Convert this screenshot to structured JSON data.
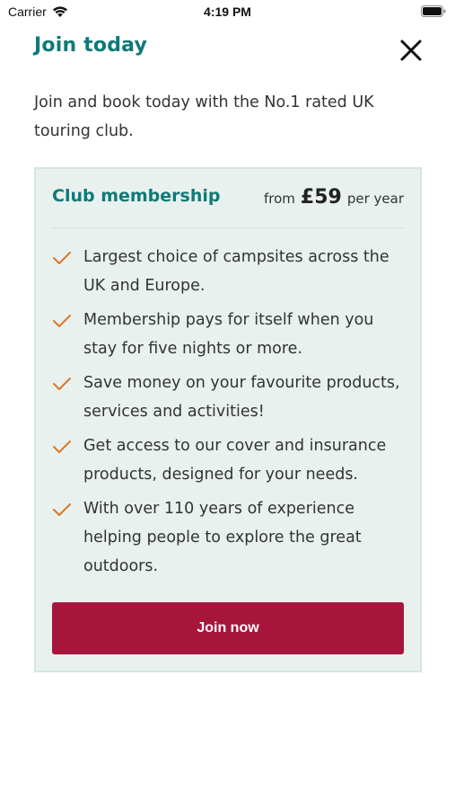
{
  "status_bar": {
    "carrier": "Carrier",
    "time": "4:19 PM"
  },
  "header": {
    "title": "Join today",
    "close_icon": "close-icon"
  },
  "intro": "Join and book today with the No.1 rated UK touring club.",
  "membership": {
    "title": "Club membership",
    "price_from": "from",
    "price_amount": "£59",
    "price_per": "per year",
    "features": [
      "Largest choice of campsites across the UK and Europe.",
      "Membership pays for itself when you stay for five nights or more.",
      "Save money on your favourite products, services and activities!",
      "Get access to our cover and insurance products, designed for your needs.",
      "With over 110 years of experience helping people to explore the great outdoors."
    ],
    "button_label": "Join now"
  },
  "colors": {
    "brand_teal": "#0e7a78",
    "card_background": "#e9f1ee",
    "button": "#a8153c",
    "check": "#d9782a"
  }
}
